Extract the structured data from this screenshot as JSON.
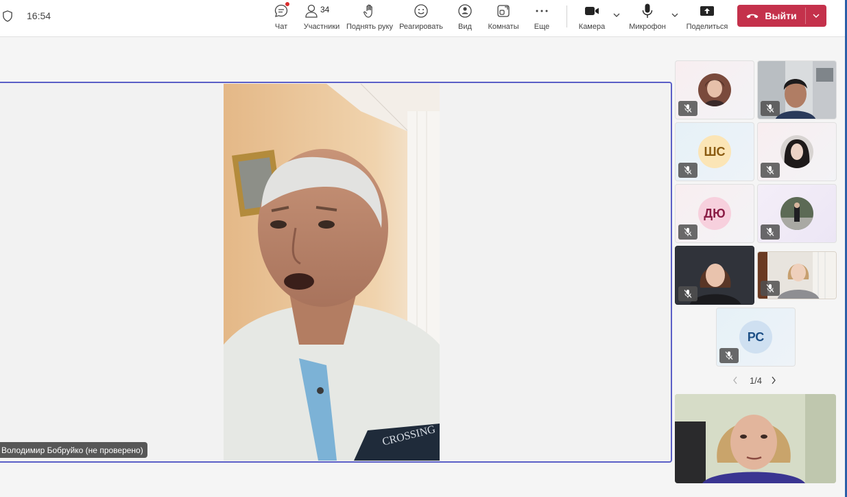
{
  "header": {
    "time": "16:54",
    "tools": {
      "chat": "Чат",
      "participants": "Участники",
      "participants_count": "34",
      "raise_hand": "Поднять руку",
      "react": "Реагировать",
      "view": "Вид",
      "rooms": "Комнаты",
      "more": "Еще",
      "camera": "Камера",
      "microphone": "Микрофон",
      "share": "Поделиться"
    },
    "leave_label": "Выйти"
  },
  "stage": {
    "speaker_name": "Володимир Бобруйко (не проверено)",
    "shirt_print": "CROSSING"
  },
  "tiles": {
    "shs": "ШС",
    "dyu": "ДЮ",
    "rs": "РС"
  },
  "pager": {
    "label": "1/4"
  },
  "colors": {
    "leave_red": "#c4314b",
    "stage_border": "#5b5fc7",
    "notification_dot": "#d92c2c"
  }
}
